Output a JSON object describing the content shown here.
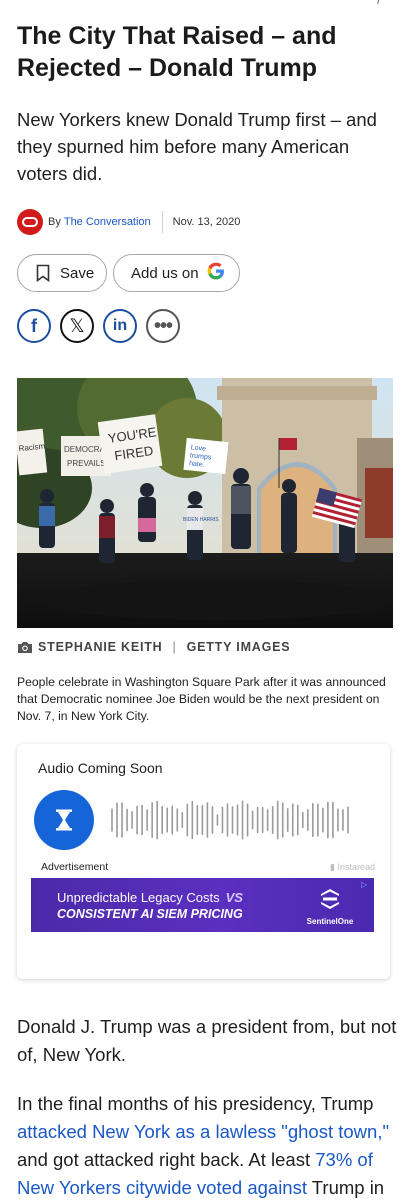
{
  "top_glyph": "/",
  "article": {
    "headline": "The City That Raised – and Rejected – Donald Trump",
    "subhead": "New Yorkers knew Donald Trump first – and they spurned him before many American voters did.",
    "byline": {
      "by": "By",
      "source": "The Conversation",
      "date": "Nov. 13, 2020",
      "logo_icon": "speech-bubble-icon"
    },
    "actions": {
      "save_label": "Save",
      "add_us_label": "Add us on",
      "add_us_glyph": "G"
    },
    "share": {
      "facebook": "f",
      "x": "𝕏",
      "linkedin": "in",
      "more": "•••"
    },
    "photo": {
      "credit_photographer": "STEPHANIE KEITH",
      "credit_separator": "|",
      "credit_agency": "GETTY IMAGES",
      "caption": "People celebrate in Washington Square Park after it was announced that Democratic nominee Joe Biden would be the next president on Nov. 7, in New York City.",
      "signs": {
        "left": "Racism",
        "democracy_line1": "DEMOCRACY",
        "democracy_line2": "PREVAILS",
        "youre_fired_line1": "YOU'RE",
        "youre_fired_line2": "FIRED",
        "love_line1": "Love",
        "love_line2": "trumps",
        "love_line3": "hate.",
        "shirt": "BIDEN HARRIS"
      }
    },
    "audio": {
      "title": "Audio Coming Soon",
      "icon": "hourglass-icon",
      "ad_label": "Advertisement",
      "instaread": "Instaread",
      "ad": {
        "line1": "Unpredictable Legacy Costs",
        "vs": "VS",
        "line2": "CONSISTENT AI SIEM PRICING",
        "brand": "SentinelOne",
        "choice": "▷"
      }
    },
    "body": {
      "para1": "Donald J. Trump was a president from, but not of, New York.",
      "para2_part1": "In the final months of his presidency, Trump ",
      "para2_link1": "attacked New York as a lawless \"ghost town,\"",
      "para2_part2": " and got attacked right back. At least ",
      "para2_link2": "73% of New Yorkers citywide voted against",
      "para2_part3": " Trump in the presidential election, and then celebrated"
    }
  },
  "colors": {
    "link": "#1a58c6",
    "accent_red": "#d11a1a",
    "audio_blue": "#1565d8",
    "share_blue": "#1d4f9e",
    "ad_purple": "#4b2aa8"
  }
}
